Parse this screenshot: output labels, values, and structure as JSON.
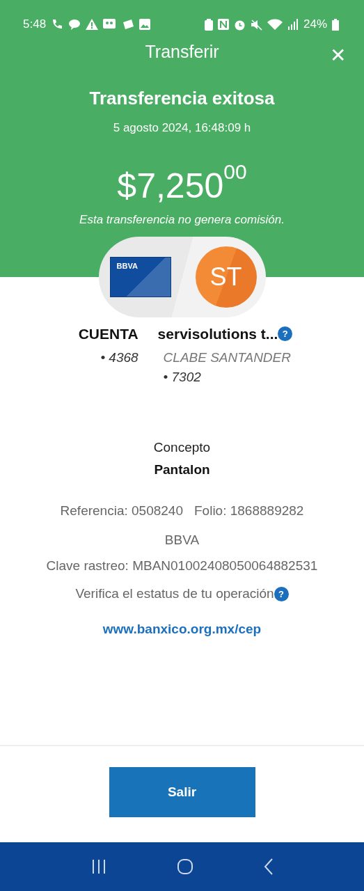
{
  "status_bar": {
    "time": "5:48",
    "battery": "24%"
  },
  "header": {
    "title": "Transferir",
    "close_glyph": "✕"
  },
  "result": {
    "heading": "Transferencia exitosa",
    "date": "5 agosto 2024, 16:48:09 h",
    "amount": "$7,250$^{00}$",
    "note": "Esta transferencia no genera comisión."
  },
  "origin": {
    "card_brand": "BBVA",
    "name": "CUENTA",
    "account": "• 4368"
  },
  "destination": {
    "initials": "ST",
    "name": "servisolutions t...",
    "help_glyph": "?",
    "bank": "CLABE SANTANDER",
    "account": "• 7302"
  },
  "details": {
    "concept_label": "Concepto",
    "concept": "Pantalon",
    "reference": "Referencia: 0508240",
    "folio": "Folio: 1868889282",
    "bank": "BBVA",
    "tracking": "Clave rastreo: MBAN01002408050064882531",
    "verify": "Verifica el estatus de tu operación",
    "verify_help_glyph": "?",
    "link": "www.banxico.org.mx/cep"
  },
  "button": "Salir"
}
